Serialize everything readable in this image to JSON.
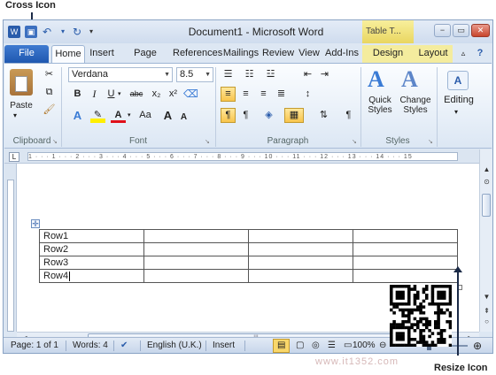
{
  "annotations": {
    "cross_icon_label": "Cross Icon",
    "resize_icon_label": "Resize Icon"
  },
  "window": {
    "title": "Document1 - Microsoft Word",
    "contextual_tab_group": "Table T...",
    "controls": {
      "minimize": "−",
      "maximize": "▭",
      "close": "✕"
    }
  },
  "tabs": {
    "file": "File",
    "home": "Home",
    "insert": "Insert",
    "page_layout": "Page Layout",
    "references": "References",
    "mailings": "Mailings",
    "review": "Review",
    "view": "View",
    "add_ins": "Add-Ins",
    "design": "Design",
    "layout": "Layout"
  },
  "ribbon": {
    "clipboard": {
      "paste": "Paste",
      "group_label": "Clipboard"
    },
    "font": {
      "family": "Verdana",
      "size": "8.5",
      "group_label": "Font",
      "bold": "B",
      "italic": "I",
      "underline": "U",
      "strike": "abc",
      "subscript": "x₂",
      "superscript": "x²",
      "grow": "A",
      "shrink": "A",
      "case": "Aa",
      "color_glyph": "A"
    },
    "paragraph": {
      "group_label": "Paragraph",
      "pilcrow": "¶"
    },
    "styles": {
      "quick_styles": "Quick Styles",
      "change_styles": "Change Styles",
      "group_label": "Styles"
    },
    "editing": {
      "label": "Editing"
    }
  },
  "ruler": {
    "marks": "1 · · · 1 · · · 2 · · · 3 · · · 4 · · · 5 · · · 6 · · · 7 · · · 8 · · · 9 · · · 10 · · · 11 · · · 12 · · · 13 · · · 14 · · · 15"
  },
  "document": {
    "move_handle_glyph": "✛",
    "table_rows": [
      [
        "Row1",
        "",
        "",
        ""
      ],
      [
        "Row2",
        "",
        "",
        ""
      ],
      [
        "Row3",
        "",
        "",
        ""
      ],
      [
        "Row4",
        "",
        "",
        ""
      ]
    ]
  },
  "statusbar": {
    "page": "Page: 1 of 1",
    "words": "Words: 4",
    "language": "English (U.K.)",
    "mode": "Insert",
    "zoom": "100%"
  },
  "watermark": "www.it1352.com",
  "colors": {
    "accent_blue": "#1f58b0",
    "contextual_yellow": "#f4ec9e",
    "callout_arrow": "#1b2a47"
  }
}
